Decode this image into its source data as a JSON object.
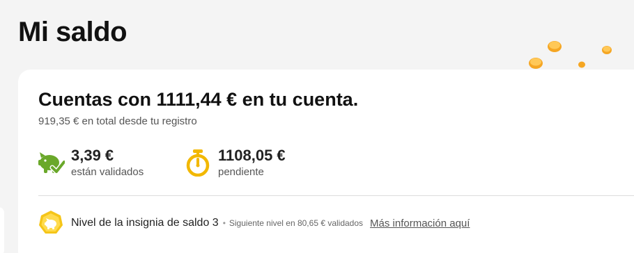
{
  "page": {
    "title": "Mi saldo"
  },
  "balance": {
    "headline": "Cuentas con 1111,44 € en tu cuenta.",
    "total_since_registration": "919,35 € en total desde tu registro"
  },
  "stats": {
    "validated": {
      "value": "3,39 €",
      "label": "están validados",
      "icon": "piggy-check-icon",
      "color": "#6aa82a"
    },
    "pending": {
      "value": "1108,05 €",
      "label": "pendiente",
      "icon": "stopwatch-icon",
      "color": "#f2b800"
    }
  },
  "badge": {
    "level_text": "Nivel de la insignia de saldo 3",
    "separator": "•",
    "next_level_text": "Siguiente nivel en 80,65 € validados",
    "link_text": "Más información aquí",
    "icon": "piggy-badge-icon",
    "color": "#f5c518"
  },
  "illustration": {
    "icon": "piggy-bank-coins-illustration",
    "piggy_color": "#f7a878",
    "coin_color": "#f5a623"
  }
}
